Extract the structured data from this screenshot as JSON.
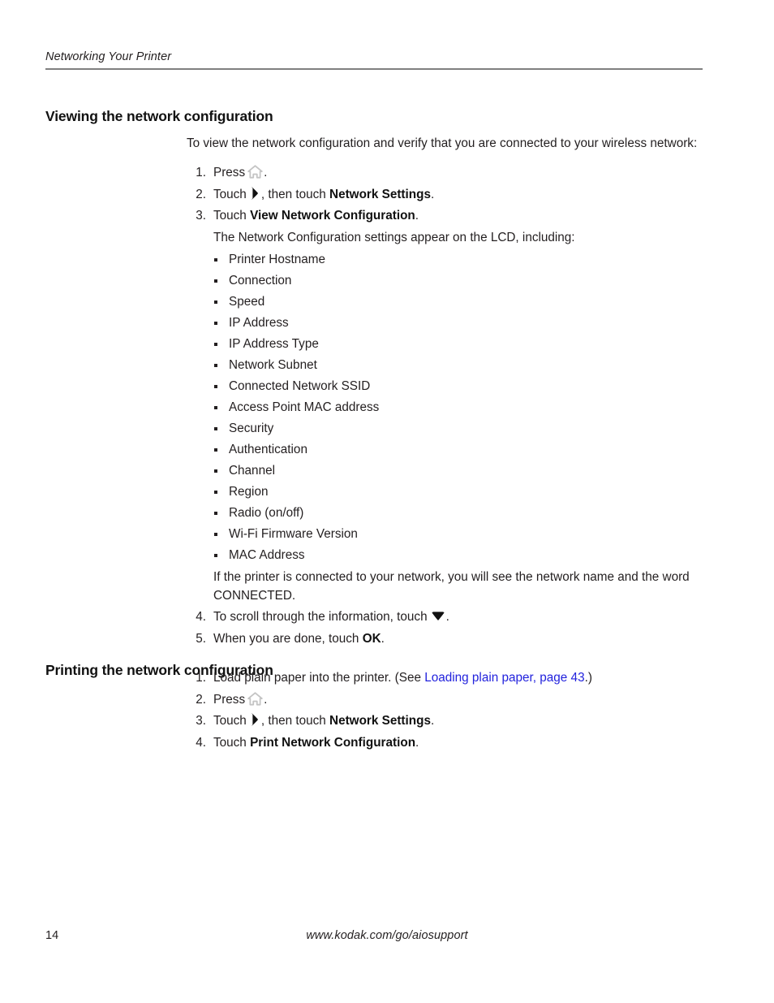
{
  "header": {
    "running_title": "Networking Your Printer"
  },
  "footer": {
    "page_number": "14",
    "url": "www.kodak.com/go/aiosupport"
  },
  "sections": [
    {
      "heading": "Viewing the network configuration",
      "intro": "To view the network configuration and verify that you are connected to your wireless network:",
      "steps": [
        {
          "num": "1.",
          "pre": "Press",
          "icon": "home-icon",
          "post": "."
        },
        {
          "num": "2.",
          "pre": "Touch",
          "icon": "right-triangle-icon",
          "mid": ", then touch ",
          "bold": "Network Settings",
          "post": "."
        },
        {
          "num": "3.",
          "pre": "Touch ",
          "bold": "View Network Configuration",
          "post": "."
        },
        {
          "num": "4.",
          "pre": "To scroll through the information, touch",
          "icon": "down-triangle-icon",
          "post": "."
        },
        {
          "num": "5.",
          "pre": "When you are done, touch ",
          "bold": "OK",
          "post": "."
        }
      ],
      "substack": {
        "lead_in": "The Network Configuration settings appear on the LCD, including:",
        "items": [
          "Printer Hostname",
          "Connection",
          "Speed",
          "IP Address",
          "IP Address Type",
          "Network Subnet",
          "Connected Network SSID",
          "Access Point MAC address",
          "Security",
          "Authentication",
          "Channel",
          "Region",
          "Radio (on/off)",
          "Wi-Fi Firmware Version",
          "MAC Address"
        ],
        "tail": "If the printer is connected to your network, you will see the network name and the word CONNECTED."
      }
    },
    {
      "heading": "Printing the network configuration",
      "steps": [
        {
          "num": "1.",
          "pre": "Load plain paper into the printer. (See ",
          "link": "Loading plain paper, page 43",
          "post": ".)"
        },
        {
          "num": "2.",
          "pre": "Press",
          "icon": "home-icon",
          "post": "."
        },
        {
          "num": "3.",
          "pre": "Touch",
          "icon": "right-triangle-icon",
          "mid": ", then touch ",
          "bold": "Network Settings",
          "post": "."
        },
        {
          "num": "4.",
          "pre": "Touch ",
          "bold": "Print Network Configuration",
          "post": "."
        }
      ]
    }
  ],
  "colors": {
    "text": "#231f20",
    "link": "#2222dd",
    "rule": "#808080",
    "icon_home": "#c8c8c8"
  }
}
